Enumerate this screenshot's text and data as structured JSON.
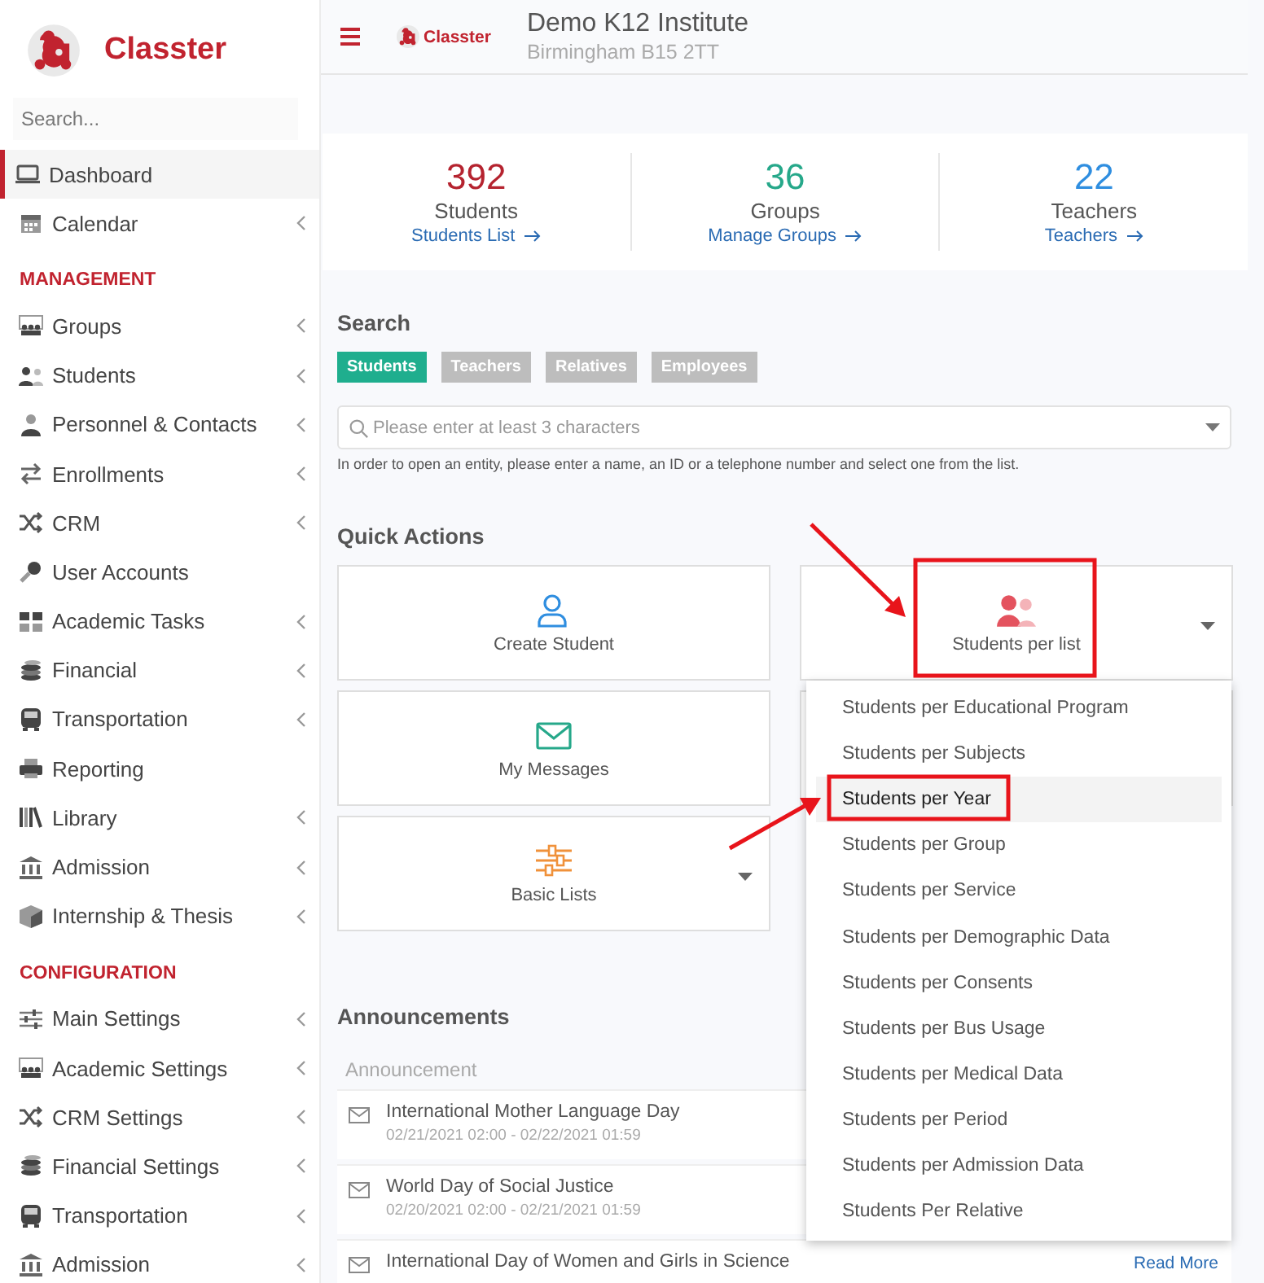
{
  "sidebar": {
    "logo_text": "Classter",
    "search": {
      "placeholder": "Search..."
    },
    "sections": [
      {
        "items": [
          {
            "label": "Dashboard",
            "selected": true,
            "expandable": false
          },
          {
            "label": "Calendar",
            "selected": false,
            "expandable": true
          }
        ]
      },
      {
        "heading": "MANAGEMENT",
        "items": [
          {
            "label": "Groups",
            "selected": false,
            "expandable": true
          },
          {
            "label": "Students",
            "selected": false,
            "expandable": true
          },
          {
            "label": "Personnel & Contacts",
            "selected": false,
            "expandable": true
          },
          {
            "label": "Enrollments",
            "selected": false,
            "expandable": true
          },
          {
            "label": "CRM",
            "selected": false,
            "expandable": true
          },
          {
            "label": "User Accounts",
            "selected": false,
            "expandable": false
          },
          {
            "label": "Academic Tasks",
            "selected": false,
            "expandable": true
          },
          {
            "label": "Financial",
            "selected": false,
            "expandable": true
          },
          {
            "label": "Transportation",
            "selected": false,
            "expandable": true
          },
          {
            "label": "Reporting",
            "selected": false,
            "expandable": false
          },
          {
            "label": "Library",
            "selected": false,
            "expandable": true
          },
          {
            "label": "Admission",
            "selected": false,
            "expandable": true
          },
          {
            "label": "Internship & Thesis",
            "selected": false,
            "expandable": true
          }
        ]
      },
      {
        "heading": "CONFIGURATION",
        "items": [
          {
            "label": "Main Settings",
            "selected": false,
            "expandable": true
          },
          {
            "label": "Academic Settings",
            "selected": false,
            "expandable": true
          },
          {
            "label": "CRM Settings",
            "selected": false,
            "expandable": true
          },
          {
            "label": "Financial Settings",
            "selected": false,
            "expandable": true
          },
          {
            "label": "Transportation",
            "selected": false,
            "expandable": true
          },
          {
            "label": "Admission",
            "selected": false,
            "expandable": true
          }
        ]
      }
    ]
  },
  "header": {
    "logo_text": "Classter",
    "title": "Demo K12 Institute",
    "subtitle": "Birmingham B15 2TT"
  },
  "stats": [
    {
      "value": "392",
      "label": "Students",
      "link": "Students List",
      "color": "#b5232f"
    },
    {
      "value": "36",
      "label": "Groups",
      "link": "Manage Groups",
      "color": "#26a88a"
    },
    {
      "value": "22",
      "label": "Teachers",
      "link": "Teachers",
      "color": "#2f8ee0"
    }
  ],
  "search": {
    "title": "Search",
    "tabs": [
      {
        "label": "Students",
        "selected": true
      },
      {
        "label": "Teachers",
        "selected": false
      },
      {
        "label": "Relatives",
        "selected": false
      },
      {
        "label": "Employees",
        "selected": false
      }
    ],
    "field": {
      "placeholder": "Please enter at least 3 characters"
    },
    "hint": "In order to open an entity, please enter a name, an ID or a telephone number and select one from the list."
  },
  "quick_actions": {
    "title": "Quick Actions",
    "items": [
      {
        "label": "Create Student",
        "has_dropdown": false
      },
      {
        "label": "Students per list",
        "has_dropdown": true
      },
      {
        "label": "My Messages",
        "has_dropdown": false
      },
      {
        "label": "Basic Lists",
        "has_dropdown": true
      }
    ],
    "menu": [
      {
        "label": "Students per Educational Program",
        "selected": false
      },
      {
        "label": "Students per Subjects",
        "selected": false
      },
      {
        "label": "Students per Year",
        "selected": true
      },
      {
        "label": "Students per Group",
        "selected": false
      },
      {
        "label": "Students per Service",
        "selected": false
      },
      {
        "label": "Students per Demographic Data",
        "selected": false
      },
      {
        "label": "Students per Consents",
        "selected": false
      },
      {
        "label": "Students per Bus Usage",
        "selected": false
      },
      {
        "label": "Students per Medical Data",
        "selected": false
      },
      {
        "label": "Students per Period",
        "selected": false
      },
      {
        "label": "Students per Admission Data",
        "selected": false
      },
      {
        "label": "Students Per Relative",
        "selected": false
      }
    ]
  },
  "announcements": {
    "title": "Announcements",
    "column": "Announcement",
    "items": [
      {
        "title": "International Mother Language Day",
        "dates": "02/21/2021 02:00 - 02/22/2021 01:59"
      },
      {
        "title": "World Day of Social Justice",
        "dates": "02/20/2021 02:00 - 02/21/2021 01:59"
      },
      {
        "title": "International Day of Women and Girls in Science",
        "link": "Read More"
      }
    ]
  }
}
